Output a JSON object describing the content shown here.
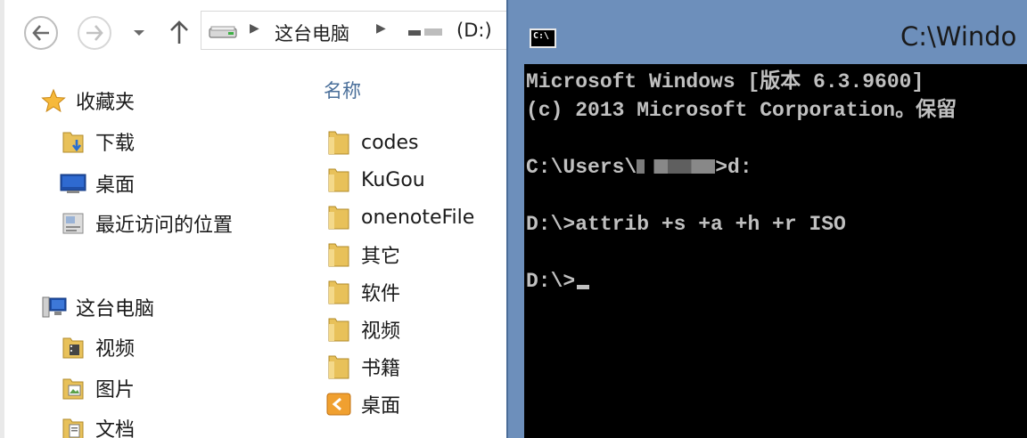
{
  "explorer": {
    "address": {
      "computer": "这台电脑",
      "drive": "(D:)"
    },
    "nav_pane": {
      "favorites": {
        "label": "收藏夹",
        "items": [
          "下载",
          "桌面",
          "最近访问的位置"
        ]
      },
      "computer": {
        "label": "这台电脑",
        "items": [
          "视频",
          "图片",
          "文档"
        ]
      }
    },
    "content": {
      "column_header": "名称",
      "files": [
        "codes",
        "KuGou",
        "onenoteFile",
        "其它",
        "软件",
        "视频",
        "书籍",
        "桌面"
      ]
    }
  },
  "cmd": {
    "title": "C:\\Windo",
    "icon_text": "C:\\",
    "lines": {
      "l1": "Microsoft Windows [版本 6.3.9600]",
      "l2": "(c) 2013 Microsoft Corporation。保留",
      "l3_a": "C:\\Users\\",
      "l3_b": ">d:",
      "l4": "D:\\>attrib +s +a +h +r ISO",
      "l5": "D:\\>"
    }
  },
  "colors": {
    "cmd_title_bg": "#6d8fbb",
    "cmd_console_bg": "#000000",
    "cmd_text": "#c0c0c0",
    "folder": "#e8c15a",
    "header_text": "#4a6f9a"
  }
}
